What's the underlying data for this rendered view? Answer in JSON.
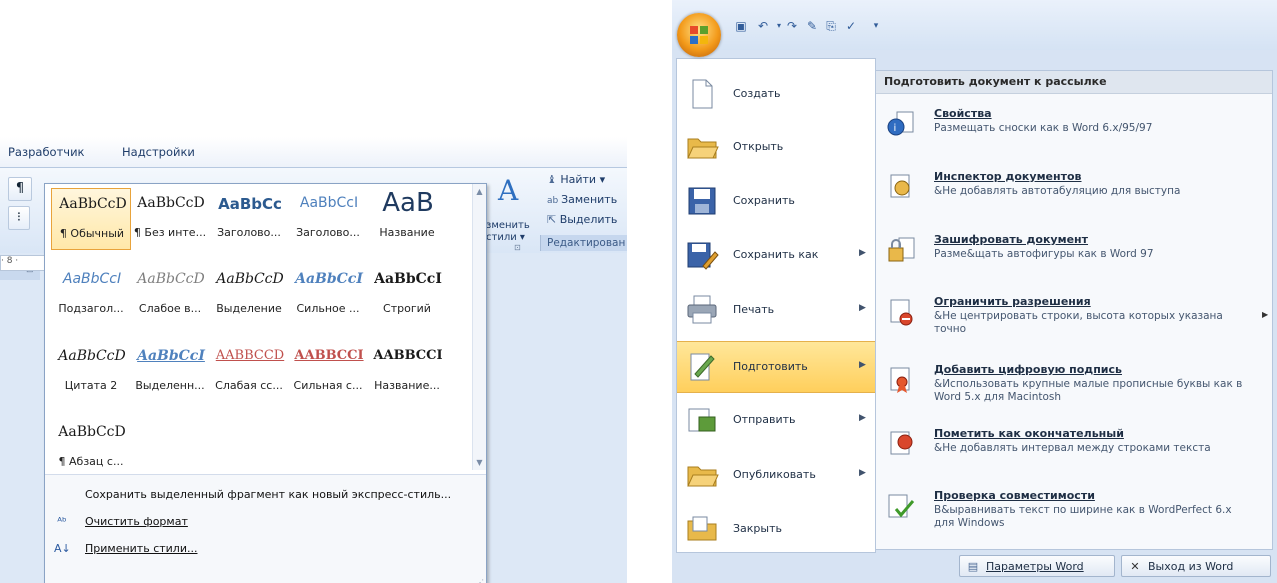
{
  "left": {
    "tabs": [
      "Разработчик",
      "Надстройки"
    ],
    "left_buttons": [
      "¶",
      "⁝",
      "⊡"
    ],
    "ruler": "· 8 ·",
    "change_styles": {
      "label_line1": "зменить",
      "label_line2": "стили ▾"
    },
    "find_group": {
      "find": "Найти ▾",
      "replace": "Заменить",
      "select": "Выделить",
      "group_label": "Редактирован"
    },
    "styles": [
      {
        "sample": "AaBbCcD",
        "name": "¶ Обычный",
        "color": "#1a1a1a",
        "font": "serif",
        "size": 14,
        "weight": "normal",
        "style": "normal",
        "selected": true
      },
      {
        "sample": "AaBbCcD",
        "name": "¶ Без инте...",
        "color": "#1a1a1a",
        "font": "serif",
        "size": 14,
        "weight": "normal",
        "style": "normal"
      },
      {
        "sample": "AaBbCc",
        "name": "Заголово...",
        "color": "#2c5a8f",
        "font": "sans",
        "size": 15,
        "weight": "bold",
        "style": "normal"
      },
      {
        "sample": "AaBbCcI",
        "name": "Заголово...",
        "color": "#4f81bd",
        "font": "sans",
        "size": 14,
        "weight": "normal",
        "style": "normal"
      },
      {
        "sample": "AaB",
        "name": "Название",
        "color": "#1f3a5f",
        "font": "sans",
        "size": 26,
        "weight": "normal",
        "style": "normal"
      },
      {
        "sample": "AaBbCcI",
        "name": "Подзагол...",
        "color": "#4f81bd",
        "font": "sans",
        "size": 14,
        "weight": "normal",
        "style": "italic"
      },
      {
        "sample": "AaBbCcD",
        "name": "Слабое в...",
        "color": "#7f7f7f",
        "font": "serif",
        "size": 14,
        "weight": "normal",
        "style": "italic"
      },
      {
        "sample": "AaBbCcD",
        "name": "Выделение",
        "color": "#1a1a1a",
        "font": "serif",
        "size": 14,
        "weight": "normal",
        "style": "italic"
      },
      {
        "sample": "AaBbCcI",
        "name": "Сильное ...",
        "color": "#4f81bd",
        "font": "serif",
        "size": 14,
        "weight": "bold",
        "style": "italic"
      },
      {
        "sample": "AaBbCcI",
        "name": "Строгий",
        "color": "#1a1a1a",
        "font": "serif",
        "size": 14,
        "weight": "bold",
        "style": "normal"
      },
      {
        "sample": "AaBbCcD",
        "name": "Цитата 2",
        "color": "#1a1a1a",
        "font": "serif",
        "size": 14,
        "weight": "normal",
        "style": "italic"
      },
      {
        "sample": "AaBbCcI",
        "name": "Выделенн...",
        "color": "#4f81bd",
        "font": "serif",
        "size": 14,
        "weight": "bold",
        "style": "italic",
        "underline": true
      },
      {
        "sample": "AABBCCD",
        "name": "Слабая сс...",
        "color": "#c0504d",
        "font": "serif",
        "size": 13,
        "weight": "normal",
        "style": "normal",
        "underline": true
      },
      {
        "sample": "AABBCCI",
        "name": "Сильная с...",
        "color": "#c0504d",
        "font": "serif",
        "size": 13,
        "weight": "bold",
        "style": "normal",
        "underline": true
      },
      {
        "sample": "AABBCCI",
        "name": "Название...",
        "color": "#1a1a1a",
        "font": "serif",
        "size": 13,
        "weight": "bold",
        "style": "normal"
      },
      {
        "sample": "AaBbCcD",
        "name": "¶ Абзац с...",
        "color": "#1a1a1a",
        "font": "serif",
        "size": 14,
        "weight": "normal",
        "style": "normal"
      }
    ],
    "menu": {
      "save_quick_style": "Сохранить выделенный фрагмент как новый экспресс-стиль...",
      "clear_format": "Очистить формат",
      "apply_styles": "Применить стили..."
    }
  },
  "right": {
    "left_menu": [
      {
        "label": "Создать",
        "icon": "new-document-icon",
        "arrow": false
      },
      {
        "label": "Открыть",
        "icon": "open-folder-icon",
        "arrow": false
      },
      {
        "label": "Сохранить",
        "icon": "save-icon",
        "arrow": false
      },
      {
        "label": "Сохранить как",
        "icon": "save-as-icon",
        "arrow": true
      },
      {
        "label": "Печать",
        "icon": "print-icon",
        "arrow": true
      },
      {
        "label": "Подготовить",
        "icon": "prepare-icon",
        "arrow": true,
        "active": true
      },
      {
        "label": "Отправить",
        "icon": "send-icon",
        "arrow": true
      },
      {
        "label": "Опубликовать",
        "icon": "publish-icon",
        "arrow": true
      },
      {
        "label": "Закрыть",
        "icon": "close-folder-icon",
        "arrow": false
      }
    ],
    "submenu_header": "Подготовить документ к рассылке",
    "submenu": [
      {
        "title": "Свойства",
        "desc": "Размещать сноски как в Word 6.x/95/97",
        "icon": "properties-icon"
      },
      {
        "title": "Инспектор документов",
        "desc": "&Не добавлять автотабуляцию для выступа",
        "icon": "inspector-icon"
      },
      {
        "title": "Зашифровать документ",
        "desc": "Разме&щать автофигуры как в Word 97",
        "icon": "encrypt-icon"
      },
      {
        "title": "Ограничить разрешения",
        "desc": "&Не центрировать строки, высота которых указана точно",
        "icon": "restrict-icon",
        "more": true
      },
      {
        "title": "Добавить цифровую подпись",
        "desc": "&Использовать крупные малые прописные буквы как в Word 5.x для Macintosh",
        "icon": "signature-icon"
      },
      {
        "title": "Пометить как окончательный",
        "desc": "&Не добавлять интервал между строками текста",
        "icon": "final-icon"
      },
      {
        "title": "Проверка совместимости",
        "desc": "В&ыравнивать текст по ширине как в WordPerfect 6.x для Windows",
        "icon": "compatibility-icon"
      }
    ],
    "word_options": "Параметры Word",
    "exit_word": "Выход из Word"
  }
}
